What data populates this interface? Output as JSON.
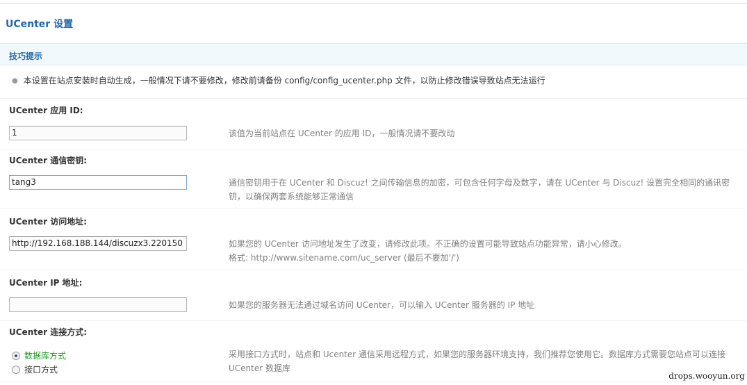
{
  "page": {
    "title": "UCenter 设置"
  },
  "tips": {
    "title": "技巧提示",
    "text": "本设置在站点安装时自动生成，一般情况下请不要修改，修改前请备份 config/config_ucenter.php 文件，以防止修改错误导致站点无法运行"
  },
  "fields": {
    "app_id": {
      "label": "UCenter 应用 ID:",
      "value": "1",
      "help": "该值为当前站点在 UCenter 的应用 ID，一般情况请不要改动"
    },
    "key": {
      "label": "UCenter 通信密钥:",
      "value": "tang3",
      "help": "通信密钥用于在 UCenter 和 Discuz! 之间传输信息的加密，可包含任何字母及数字，请在 UCenter 与 Discuz! 设置完全相同的通讯密钥，以确保两套系统能够正常通信"
    },
    "url": {
      "label": "UCenter 访问地址:",
      "value": "http://192.168.188.144/discuzx3.220150",
      "help_line1": "如果您的 UCenter 访问地址发生了改变，请修改此项。不正确的设置可能导致站点功能异常，请小心修改。",
      "help_line2": "格式: http://www.sitename.com/uc_server (最后不要加'/')"
    },
    "ip": {
      "label": "UCenter IP 地址:",
      "value": "",
      "help": "如果您的服务器无法通过域名访问 UCenter，可以输入 UCenter 服务器的 IP 地址"
    },
    "connect": {
      "label": "UCenter 连接方式:",
      "options": [
        "数据库方式",
        "接口方式"
      ],
      "selected": "数据库方式",
      "help": "采用接口方式时，站点和 Ucenter 通信采用远程方式，如果您的服务器环境支持，我们推荐您使用它。数据库方式需要您站点可以连接 UCenter 数据库"
    }
  },
  "watermark": "drops.wooyun.org"
}
